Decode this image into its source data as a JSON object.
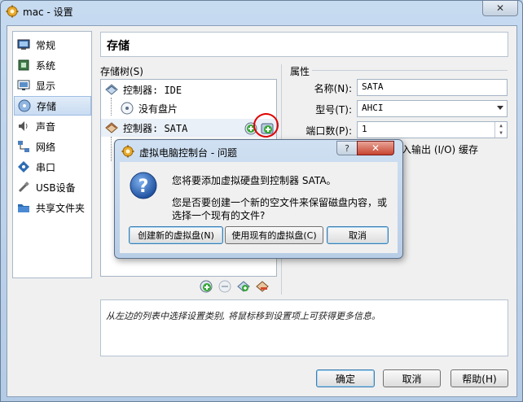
{
  "window": {
    "title": "mac - 设置",
    "close_glyph": "✕"
  },
  "sidebar": {
    "items": [
      {
        "label": "常规",
        "icon": "general-icon"
      },
      {
        "label": "系统",
        "icon": "system-icon"
      },
      {
        "label": "显示",
        "icon": "display-icon"
      },
      {
        "label": "存储",
        "icon": "storage-icon",
        "selected": true
      },
      {
        "label": "声音",
        "icon": "audio-icon"
      },
      {
        "label": "网络",
        "icon": "network-icon"
      },
      {
        "label": "串口",
        "icon": "serial-port-icon"
      },
      {
        "label": "USB设备",
        "icon": "usb-icon"
      },
      {
        "label": "共享文件夹",
        "icon": "shared-folder-icon"
      }
    ]
  },
  "page": {
    "title": "存储"
  },
  "tree": {
    "label": "存储树(S)",
    "rows": [
      {
        "label": "控制器: IDE"
      },
      {
        "label": "没有盘片"
      },
      {
        "label": "控制器: SATA"
      }
    ]
  },
  "attributes": {
    "label": "属性",
    "name_label": "名称(N):",
    "name_value": "SATA",
    "type_label": "型号(T):",
    "type_value": "AHCI",
    "ports_label": "端口数(P):",
    "ports_value": "1",
    "io_partial": "机输入输出 (I/O) 缓存"
  },
  "info": {
    "text": "从左边的列表中选择设置类别, 将鼠标移到设置项上可获得更多信息。"
  },
  "buttons": {
    "ok": "确定",
    "cancel": "取消",
    "help": "帮助(H)"
  },
  "dialog": {
    "title": "虚拟电脑控制台 - 问题",
    "help_glyph": "?",
    "close_glyph": "✕",
    "message1": "您将要添加虚拟硬盘到控制器 SATA。",
    "message2": "您是否要创建一个新的空文件来保留磁盘内容，或选择一个现有的文件?",
    "create_button": "创建新的虚拟盘(N)",
    "use_existing_button": "使用现有的虚拟盘(C)",
    "cancel_button": "取消"
  },
  "colors": {
    "highlight": "#e00000",
    "accent": "#3c7fb1"
  }
}
